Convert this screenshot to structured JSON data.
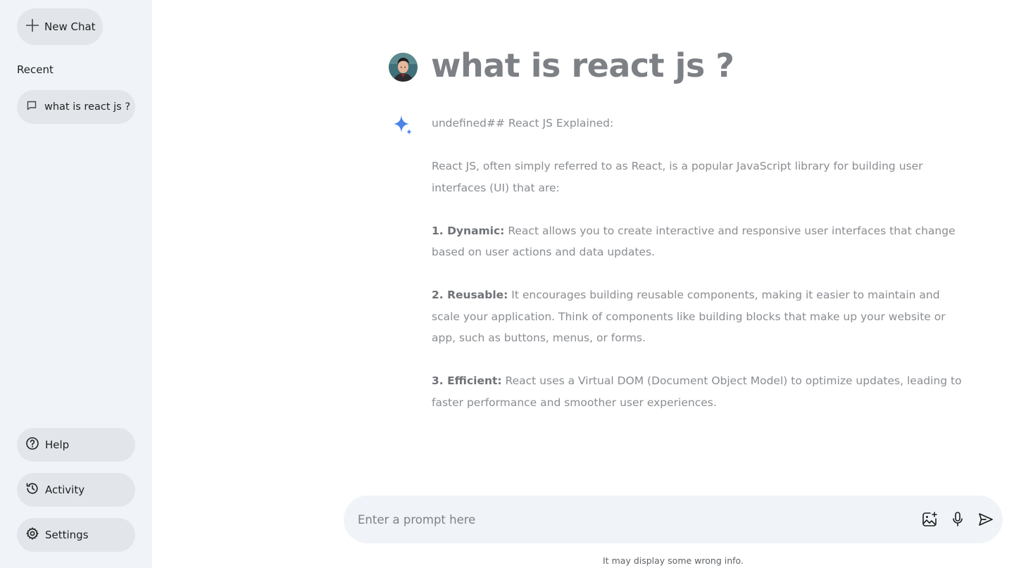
{
  "sidebar": {
    "new_chat_label": "New Chat",
    "recent_title": "Recent",
    "recent_items": [
      {
        "label": "what is react js ?",
        "icon": "message-icon"
      }
    ],
    "bottom_items": [
      {
        "label": "Help",
        "icon": "help-icon"
      },
      {
        "label": "Activity",
        "icon": "history-icon"
      },
      {
        "label": "Settings",
        "icon": "gear-icon"
      }
    ]
  },
  "chat": {
    "question": "what is react js ?",
    "answer": {
      "heading": "undefined## React JS Explained:",
      "intro": "React JS, often simply referred to as React, is a popular JavaScript library for building user interfaces (UI) that are:",
      "points": [
        {
          "title": "1. Dynamic:",
          "text": " React allows you to create interactive and responsive user interfaces that change based on user actions and data updates."
        },
        {
          "title": "2. Reusable:",
          "text": " It encourages building reusable components, making it easier to maintain and scale your application. Think of components like building blocks that make up your website or app, such as buttons, menus, or forms."
        },
        {
          "title": "3. Efficient:",
          "text": " React uses a Virtual DOM (Document Object Model) to optimize updates, leading to faster performance and smoother user experiences."
        }
      ]
    }
  },
  "prompt": {
    "placeholder": "Enter a prompt here",
    "value": ""
  },
  "footnote": "It may display some wrong info.",
  "colors": {
    "sidebar_bg": "#f0f4f9",
    "pill_bg": "#e2e6eb",
    "question_text": "#7d8084",
    "answer_text": "#8a8d91",
    "gemini_blue": "#4b83e6"
  }
}
